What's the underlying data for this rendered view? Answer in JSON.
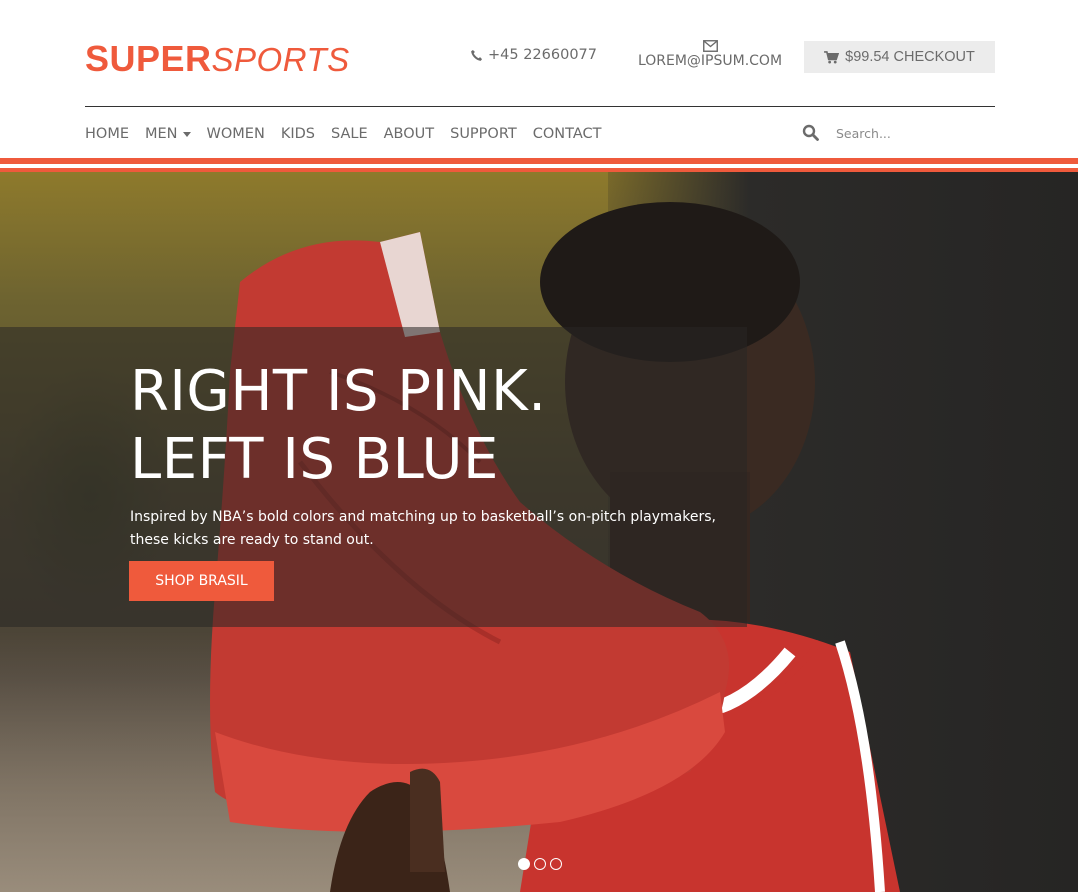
{
  "brand": {
    "super": "SUPER",
    "sports": "SPORTS",
    "accent_color": "#ef5a3c"
  },
  "contact": {
    "phone_icon": "phone-icon",
    "phone": "+45 22660077",
    "email_icon": "envelope-icon",
    "email": "LOREM@IPSUM.COM"
  },
  "cart": {
    "icon": "cart-icon",
    "label": "$99.54 CHECKOUT"
  },
  "nav": {
    "items": [
      {
        "label": "HOME"
      },
      {
        "label": "MEN",
        "dropdown": true
      },
      {
        "label": "WOMEN"
      },
      {
        "label": "KIDS"
      },
      {
        "label": "SALE"
      },
      {
        "label": "ABOUT"
      },
      {
        "label": "SUPPORT"
      },
      {
        "label": "CONTACT"
      }
    ]
  },
  "search": {
    "icon": "search-icon",
    "placeholder": "Search..."
  },
  "hero": {
    "title_line1": "RIGHT IS PINK.",
    "title_line2": "LEFT IS BLUE",
    "description": "Inspired by NBA’s bold colors and matching up to basketball’s on-pitch playmakers, these kicks are ready to stand out.",
    "button_label": "SHOP BRASIL",
    "slides": 3,
    "active_slide": 1
  }
}
